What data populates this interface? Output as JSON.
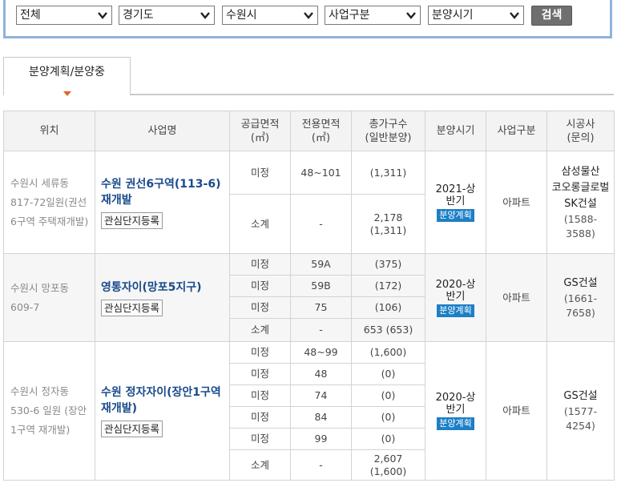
{
  "filters": {
    "selects": [
      {
        "value": "전체"
      },
      {
        "value": "경기도"
      },
      {
        "value": "수원시"
      },
      {
        "value": "사업구분"
      },
      {
        "value": "분양시기"
      }
    ],
    "search_label": "검색"
  },
  "tab": {
    "label": "분양계획/분양중"
  },
  "table": {
    "headers": {
      "location": "위치",
      "project": "사업명",
      "supply_area": "공급면적\n(㎡)",
      "exclusive_area": "전용면적\n(㎡)",
      "total_units": "총가구수\n(일반분양)",
      "sale_period": "분양시기",
      "business_type": "사업구분",
      "constructor": "시공사\n(문의)"
    },
    "watch_label": "관심단지등록",
    "rows": [
      {
        "location": "수원시 세류동 817-72일원(권선6구역 주택재개발)",
        "project": "수원 권선6구역(113-6) 재개발",
        "subrows": [
          {
            "supply": "미정",
            "exclusive": "48~101",
            "units": "(1,311)"
          },
          {
            "supply": "소계",
            "exclusive": "-",
            "units": "2,178\n(1,311)"
          }
        ],
        "period": "2021-상반기",
        "badge": "분양계획",
        "type": "아파트",
        "constructor": "삼성물산\n코오롱글로벌\nSK건설",
        "phone": "(1588-\n3588)"
      },
      {
        "location": "수원시 망포동 609-7",
        "project": "영통자이(망포5지구)",
        "subrows": [
          {
            "supply": "미정",
            "exclusive": "59A",
            "units": "(375)"
          },
          {
            "supply": "미정",
            "exclusive": "59B",
            "units": "(172)"
          },
          {
            "supply": "미정",
            "exclusive": "75",
            "units": "(106)"
          },
          {
            "supply": "소계",
            "exclusive": "-",
            "units": "653 (653)"
          }
        ],
        "period": "2020-상반기",
        "badge": "분양계획",
        "type": "아파트",
        "constructor": "GS건설",
        "phone": "(1661-\n7658)"
      },
      {
        "location": "수원시 정자동 530-6 일원 (장안1구역 재개발)",
        "project": "수원 정자자이(장안1구역 재개발)",
        "subrows": [
          {
            "supply": "미정",
            "exclusive": "48~99",
            "units": "(1,600)"
          },
          {
            "supply": "미정",
            "exclusive": "48",
            "units": "(0)"
          },
          {
            "supply": "미정",
            "exclusive": "74",
            "units": "(0)"
          },
          {
            "supply": "미정",
            "exclusive": "84",
            "units": "(0)"
          },
          {
            "supply": "미정",
            "exclusive": "99",
            "units": "(0)"
          },
          {
            "supply": "소계",
            "exclusive": "-",
            "units": "2,607\n(1,600)"
          }
        ],
        "period": "2020-상반기",
        "badge": "분양계획",
        "type": "아파트",
        "constructor": "GS건설",
        "phone": "(1577-\n4254)"
      }
    ]
  }
}
